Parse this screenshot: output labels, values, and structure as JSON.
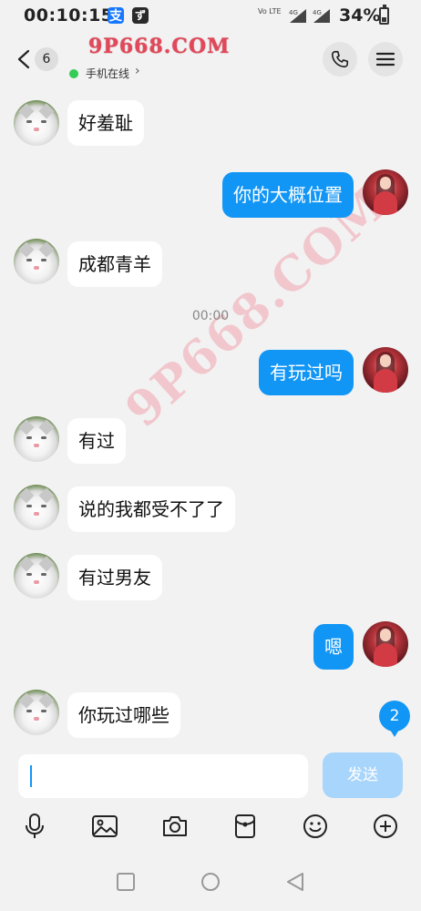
{
  "status_bar": {
    "time": "00:10:15",
    "app_icons": [
      "alipay-icon",
      "app-icon"
    ],
    "alipay_glyph": "支",
    "app_glyph": "ず",
    "volte_label": "Vo LTE",
    "sim_indicators": [
      "4G",
      "4G"
    ],
    "battery_percent": "34%",
    "battery_level": 0.34
  },
  "header": {
    "unread_count": "6",
    "contact_name": "9P668.COM",
    "online_status": "手机在线",
    "online_chevron": "›",
    "actions": [
      "phone-icon",
      "menu-icon"
    ]
  },
  "chat": {
    "time_divider": "00:00",
    "watermark": "9P668.COM",
    "messages": [
      {
        "direction": "in",
        "text": "好羞耻"
      },
      {
        "direction": "out",
        "text": "你的大概位置"
      },
      {
        "direction": "in",
        "text": "成都青羊"
      },
      {
        "direction": "out",
        "text": "有玩过吗"
      },
      {
        "direction": "in",
        "text": "有过"
      },
      {
        "direction": "in",
        "text": "说的我都受不了了"
      },
      {
        "direction": "in",
        "text": "有过男友"
      },
      {
        "direction": "out",
        "text": "嗯"
      },
      {
        "direction": "in",
        "text": "你玩过哪些"
      }
    ],
    "new_message_badge": "2"
  },
  "input_bar": {
    "value": "",
    "send_label": "发送"
  },
  "toolbar": {
    "tools": [
      "microphone-icon",
      "image-icon",
      "camera-icon",
      "red-packet-icon",
      "emoji-icon",
      "plus-icon"
    ]
  },
  "nav_bar": {
    "buttons": [
      "recents-icon",
      "home-icon",
      "back-icon"
    ]
  },
  "colors": {
    "outgoing_bubble": "#1296f5",
    "incoming_bubble": "#ffffff",
    "send_button_disabled": "#a8d5fb",
    "online_dot": "#33cc55",
    "contact_name": "#e3485a"
  }
}
